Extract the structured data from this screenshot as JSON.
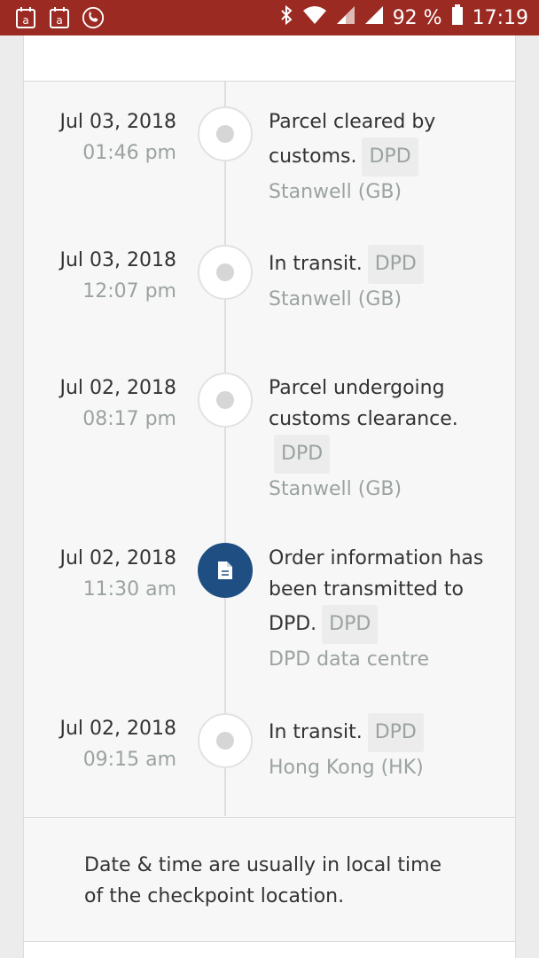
{
  "status_bar": {
    "battery_percent": "92 %",
    "clock": "17:19",
    "left_icons": [
      "calendar-icon",
      "calendar-icon",
      "phone-call-icon"
    ],
    "right_icons": [
      "bluetooth-icon",
      "wifi-icon",
      "signal-icon",
      "signal-icon",
      "battery-icon"
    ]
  },
  "events": [
    {
      "date": "Jul 03, 2018",
      "time": "01:46 pm",
      "status": "Parcel cleared by customs.",
      "carrier": "DPD",
      "location": "Stanwell (GB)",
      "active": false
    },
    {
      "date": "Jul 03, 2018",
      "time": "12:07 pm",
      "status": "In transit.",
      "carrier": "DPD",
      "location": "Stanwell (GB)",
      "active": false
    },
    {
      "date": "Jul 02, 2018",
      "time": "08:17 pm",
      "status": "Parcel undergoing customs clearance.",
      "carrier": "DPD",
      "location": "Stanwell (GB)",
      "active": false
    },
    {
      "date": "Jul 02, 2018",
      "time": "11:30 am",
      "status": "Order information has been transmitted to DPD.",
      "carrier": "DPD",
      "location": "DPD data centre",
      "active": true
    },
    {
      "date": "Jul 02, 2018",
      "time": "09:15 am",
      "status": "In transit.",
      "carrier": "DPD",
      "location": "Hong Kong (HK)",
      "active": false
    }
  ],
  "note": "Date & time are usually in local time of the checkpoint location.",
  "colors": {
    "status_bar": "#9b2b22",
    "active_dot": "#1f4f82",
    "muted_text": "#9aa3a0"
  }
}
